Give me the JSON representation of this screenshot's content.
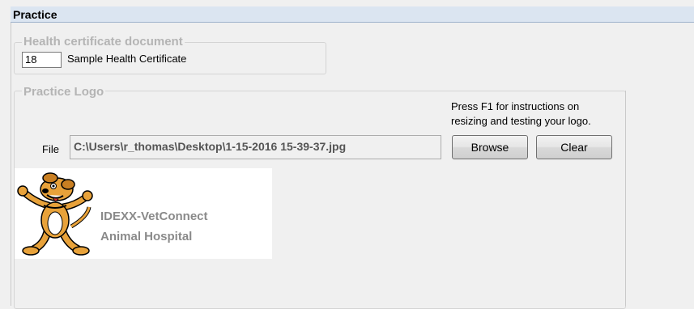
{
  "window": {
    "title": "Practice"
  },
  "health_certificate": {
    "legend": "Health certificate document",
    "number": "18",
    "name": "Sample Health Certificate"
  },
  "practice_logo": {
    "legend": "Practice Logo",
    "instructions_line1": "Press F1 for instructions on",
    "instructions_line2": "resizing and testing your logo.",
    "file_label": "File",
    "file_path": "C:\\Users\\r_thomas\\Desktop\\1-15-2016 15-39-37.jpg",
    "browse_label": "Browse",
    "clear_label": "Clear",
    "logo_line1": "IDEXX-VetConnect",
    "logo_line2": "Animal Hospital"
  },
  "colors": {
    "title_bar": "#dbe5f1",
    "legend_text": "#b4b4b4",
    "logo_text": "#8a8a8a",
    "dog_fur": "#e8a23a"
  }
}
